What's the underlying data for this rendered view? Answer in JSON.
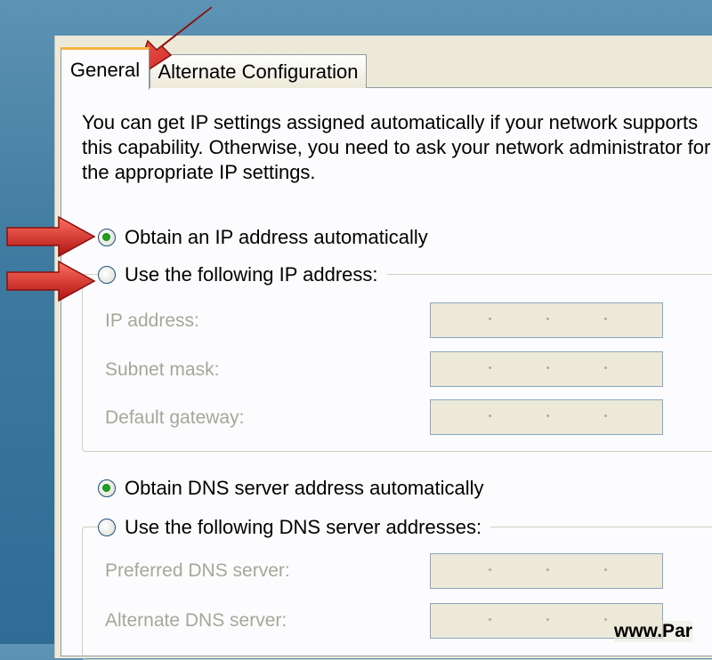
{
  "tabs": {
    "general": "General",
    "alternate": "Alternate Configuration"
  },
  "intro_text": "You can get IP settings assigned automatically if your network supports\nthis capability. Otherwise, you need to ask your network administrator for\nthe appropriate IP settings.",
  "ip": {
    "auto_label": "Obtain an IP address automatically",
    "auto_checked": true,
    "manual_label": "Use the following IP address:",
    "fields": [
      {
        "label": "IP address:"
      },
      {
        "label": "Subnet mask:"
      },
      {
        "label": "Default gateway:"
      }
    ]
  },
  "dns": {
    "auto_label": "Obtain DNS server address automatically",
    "auto_checked": true,
    "manual_label": "Use the following DNS server addresses:",
    "fields": [
      {
        "label": "Preferred DNS server:"
      },
      {
        "label": "Alternate DNS server:"
      }
    ]
  },
  "watermark": "www.Par",
  "colors": {
    "arrow": "#d42020",
    "radio_dot": "#21a121",
    "tab_highlight": "#f9b342"
  }
}
